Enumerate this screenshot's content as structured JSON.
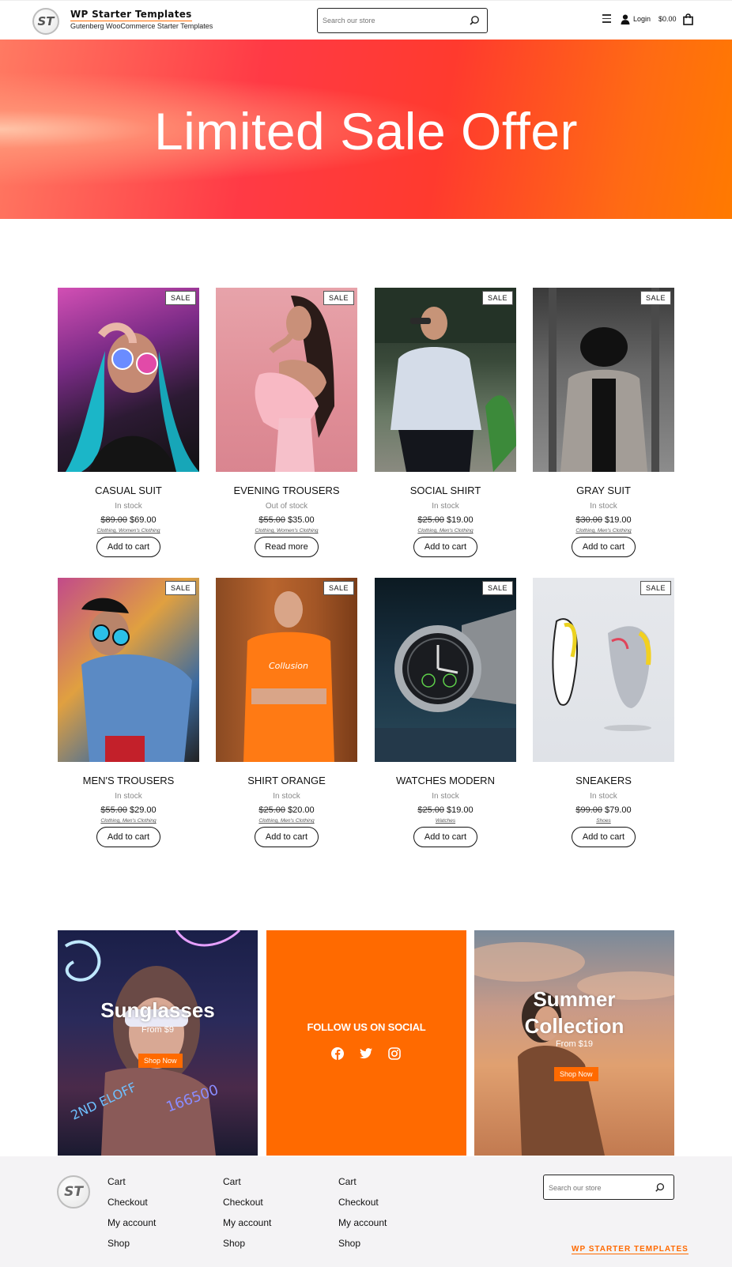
{
  "header": {
    "logo_text": "ST",
    "site_title": "WP Starter Templates",
    "tagline": "Gutenberg WooCommerce Starter Templates",
    "search_placeholder": "Search our store",
    "login_label": "Login",
    "cart_total": "$0.00",
    "icons": [
      "menu-icon",
      "user-icon",
      "shopping-bag-icon",
      "search-icon"
    ]
  },
  "hero": {
    "title": "Limited Sale Offer"
  },
  "badges": {
    "sale": "SALE"
  },
  "products": [
    {
      "name": "CASUAL SUIT",
      "stock": "In stock",
      "old_price": "$89.00",
      "price": "$69.00",
      "categories": "Clothing, Women's Clothing",
      "button": "Add to cart"
    },
    {
      "name": "EVENING TROUSERS",
      "stock": "Out of stock",
      "old_price": "$55.00",
      "price": "$35.00",
      "categories": "Clothing, Women's Clothing",
      "button": "Read more"
    },
    {
      "name": "SOCIAL SHIRT",
      "stock": "In stock",
      "old_price": "$25.00",
      "price": "$19.00",
      "categories": "Clothing, Men's Clothing",
      "button": "Add to cart"
    },
    {
      "name": "GRAY SUIT",
      "stock": "In stock",
      "old_price": "$30.00",
      "price": "$19.00",
      "categories": "Clothing, Men's Clothing",
      "button": "Add to cart"
    },
    {
      "name": "MEN'S TROUSERS",
      "stock": "In stock",
      "old_price": "$55.00",
      "price": "$29.00",
      "categories": "Clothing, Men's Clothing",
      "button": "Add to cart"
    },
    {
      "name": "SHIRT ORANGE",
      "stock": "In stock",
      "old_price": "$25.00",
      "price": "$20.00",
      "categories": "Clothing, Men's Clothing",
      "button": "Add to cart"
    },
    {
      "name": "WATCHES MODERN",
      "stock": "In stock",
      "old_price": "$25.00",
      "price": "$19.00",
      "categories": "Watches",
      "button": "Add to cart"
    },
    {
      "name": "SNEAKERS",
      "stock": "In stock",
      "old_price": "$99.00",
      "price": "$79.00",
      "categories": "Shoes",
      "button": "Add to cart"
    }
  ],
  "promos": {
    "sunglasses": {
      "title": "Sunglasses",
      "subtitle": "From $9",
      "button": "Shop Now"
    },
    "social": {
      "title": "FOLLOW US ON SOCIAL",
      "icons": [
        "facebook-icon",
        "twitter-icon",
        "instagram-icon"
      ]
    },
    "summer": {
      "title_line1": "Summer",
      "title_line2": "Collection",
      "subtitle": "From $19",
      "button": "Shop Now"
    }
  },
  "footer": {
    "logo_text": "ST",
    "columns": [
      [
        "Cart",
        "Checkout",
        "My account",
        "Shop"
      ],
      [
        "Cart",
        "Checkout",
        "My account",
        "Shop"
      ],
      [
        "Cart",
        "Checkout",
        "My account",
        "Shop"
      ]
    ],
    "search_placeholder": "Search our store",
    "brand_link": "WP STARTER TEMPLATES"
  },
  "colors": {
    "accent": "#ff6a00",
    "hero_red": "#ff3a45",
    "hero_orange": "#ff7a00"
  }
}
